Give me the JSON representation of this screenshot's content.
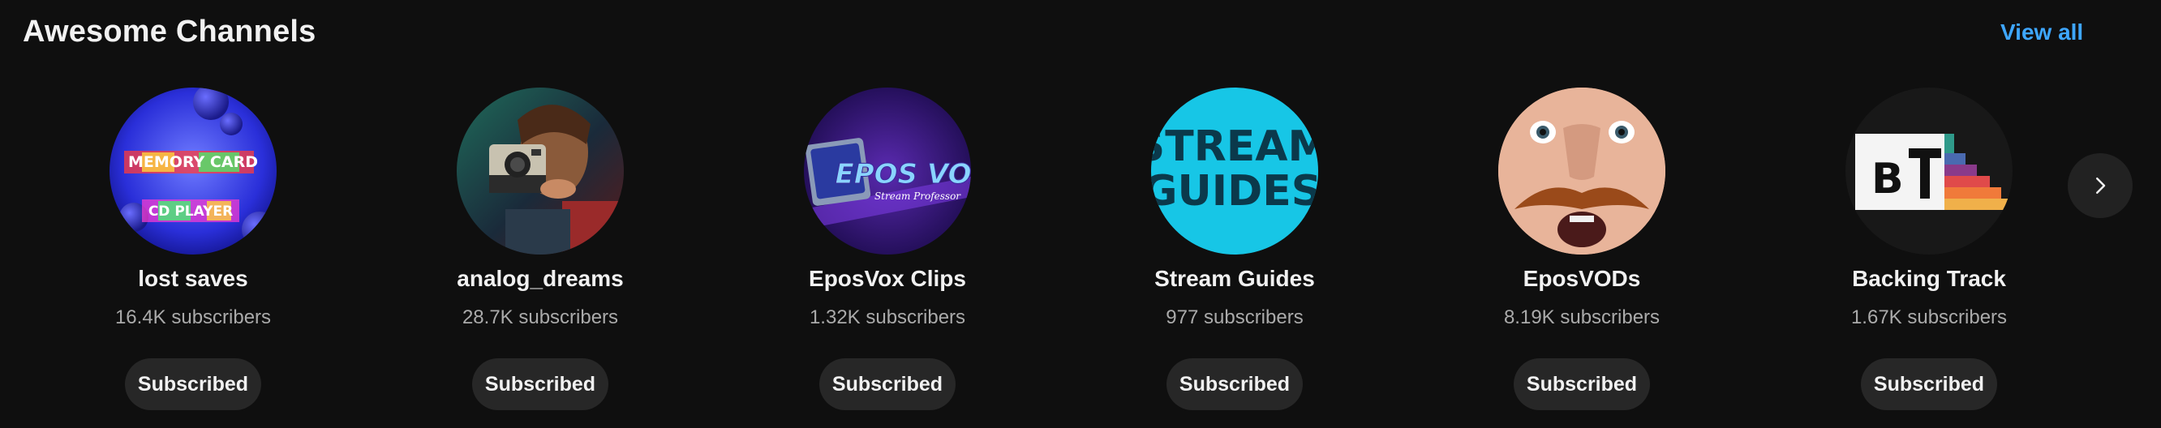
{
  "shelf": {
    "title": "Awesome Channels",
    "view_all_label": "View all"
  },
  "channels": [
    {
      "name": "lost saves",
      "subscribers": "16.4K subscribers",
      "button_label": "Subscribed",
      "avatar_text": [
        "MEMORY CARD",
        "CD PLAYER"
      ]
    },
    {
      "name": "analog_dreams",
      "subscribers": "28.7K subscribers",
      "button_label": "Subscribed"
    },
    {
      "name": "EposVox Clips",
      "subscribers": "1.32K subscribers",
      "button_label": "Subscribed",
      "avatar_text": [
        "EPOS VOX",
        "Stream Professor"
      ]
    },
    {
      "name": "Stream Guides",
      "subscribers": "977 subscribers",
      "button_label": "Subscribed",
      "avatar_text": [
        "STREAM",
        "GUIDES"
      ]
    },
    {
      "name": "EposVODs",
      "subscribers": "8.19K subscribers",
      "button_label": "Subscribed"
    },
    {
      "name": "Backing Track",
      "subscribers": "1.67K subscribers",
      "button_label": "Subscribed",
      "avatar_text": [
        "B"
      ]
    }
  ],
  "navigation": {
    "next_icon": "chevron-right-icon"
  },
  "colors": {
    "background": "#0f0f0f",
    "accent": "#3ea6ff",
    "button_bg": "#272727",
    "secondary_text": "#aaaaaa"
  }
}
